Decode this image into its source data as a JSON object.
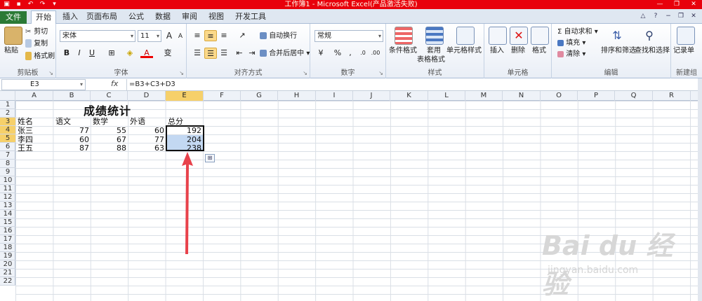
{
  "window": {
    "title": "工作簿1 - Microsoft Excel(产品激活失败)",
    "accent": "#e8000b"
  },
  "tabs": [
    "文件",
    "开始",
    "插入",
    "页面布局",
    "公式",
    "数据",
    "审阅",
    "视图",
    "开发工具"
  ],
  "active_tab": "开始",
  "ribbon": {
    "clipboard": {
      "paste": "粘贴",
      "cut": "剪切",
      "copy": "复制",
      "format_painter": "格式刷",
      "label": "剪贴板"
    },
    "font": {
      "name": "宋体",
      "size": "11",
      "bold": "B",
      "italic": "I",
      "underline": "U",
      "label": "字体",
      "grow": "A",
      "shrink": "A",
      "wen": "变"
    },
    "alignment": {
      "wrap": "自动换行",
      "merge": "合并后居中",
      "label": "对齐方式"
    },
    "number": {
      "format": "常规",
      "percent": "%",
      "comma": ",",
      "label": "数字"
    },
    "styles": {
      "conditional": "条件格式",
      "table": "套用",
      "table2": "表格格式",
      "cell_styles": "单元格样式",
      "label": "样式"
    },
    "cells": {
      "insert": "插入",
      "delete": "删除",
      "format": "格式",
      "label": "单元格"
    },
    "editing": {
      "autosum": "自动求和",
      "fill": "填充",
      "clear": "清除",
      "sort": "排序和筛选",
      "find": "查找和选择",
      "label": "编辑"
    },
    "record": {
      "record": "记录单",
      "label": "新建组"
    }
  },
  "formula_bar": {
    "name_box": "E3",
    "fx": "fx",
    "formula": "=B3+C3+D3"
  },
  "columns": [
    "A",
    "B",
    "C",
    "D",
    "E",
    "F",
    "G",
    "H",
    "I",
    "J",
    "K",
    "L",
    "M",
    "N",
    "O",
    "P",
    "Q",
    "R"
  ],
  "rows": [
    "1",
    "2",
    "3",
    "4",
    "5",
    "6",
    "7",
    "8",
    "9",
    "10",
    "11",
    "12",
    "13",
    "14",
    "15",
    "16",
    "17",
    "18",
    "19",
    "20",
    "21",
    "22"
  ],
  "sheet": {
    "title": "成绩统计",
    "headers": [
      "姓名",
      "语文",
      "数学",
      "外语",
      "总分"
    ],
    "records": [
      {
        "name": "张三",
        "chinese": "77",
        "math": "55",
        "english": "60",
        "total": "192"
      },
      {
        "name": "李四",
        "chinese": "60",
        "math": "67",
        "english": "77",
        "total": "204"
      },
      {
        "name": "王五",
        "chinese": "87",
        "math": "88",
        "english": "63",
        "total": "238"
      }
    ]
  },
  "watermark": {
    "brand": "Bai du 经验",
    "url": "jingyan.baidu.com"
  }
}
